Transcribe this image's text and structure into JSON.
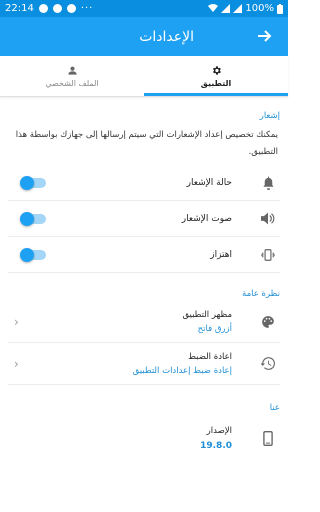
{
  "status_bar": {
    "time": "22:14",
    "battery": "100%"
  },
  "app_bar": {
    "title": "الإعدادات",
    "back_icon": "arrow-right-icon"
  },
  "tabs": [
    {
      "label": "التطبيق",
      "icon": "gear-icon",
      "active": true
    },
    {
      "label": "الملف الشخصي",
      "icon": "person-icon",
      "active": false
    }
  ],
  "notification": {
    "header": "إشعار",
    "description": "يمكنك تخصيص إعداد الإشعارات التي سيتم إرسالها إلى جهازك بواسطة هذا التطبيق.",
    "items": [
      {
        "label": "حالة الإشعار",
        "icon": "bell-icon",
        "enabled": true
      },
      {
        "label": "صوت الإشعار",
        "icon": "speaker-icon",
        "enabled": true
      },
      {
        "label": "اهتزاز",
        "icon": "vibrate-icon",
        "enabled": true
      }
    ]
  },
  "overview": {
    "header": "نظرة عامة",
    "appearance": {
      "label": "مظهر التطبيق",
      "value": "أزرق فاتح"
    },
    "reset": {
      "label": "اعادة الضبط",
      "value": "إعادة ضبط إعدادات التطبيق"
    }
  },
  "about": {
    "header": "عنا",
    "version_label": "الإصدار",
    "version_value": "19.8.0"
  },
  "colors": {
    "accent": "#1ea1f2",
    "status_bar": "#0a8fe0",
    "link": "#1e8fd6"
  }
}
